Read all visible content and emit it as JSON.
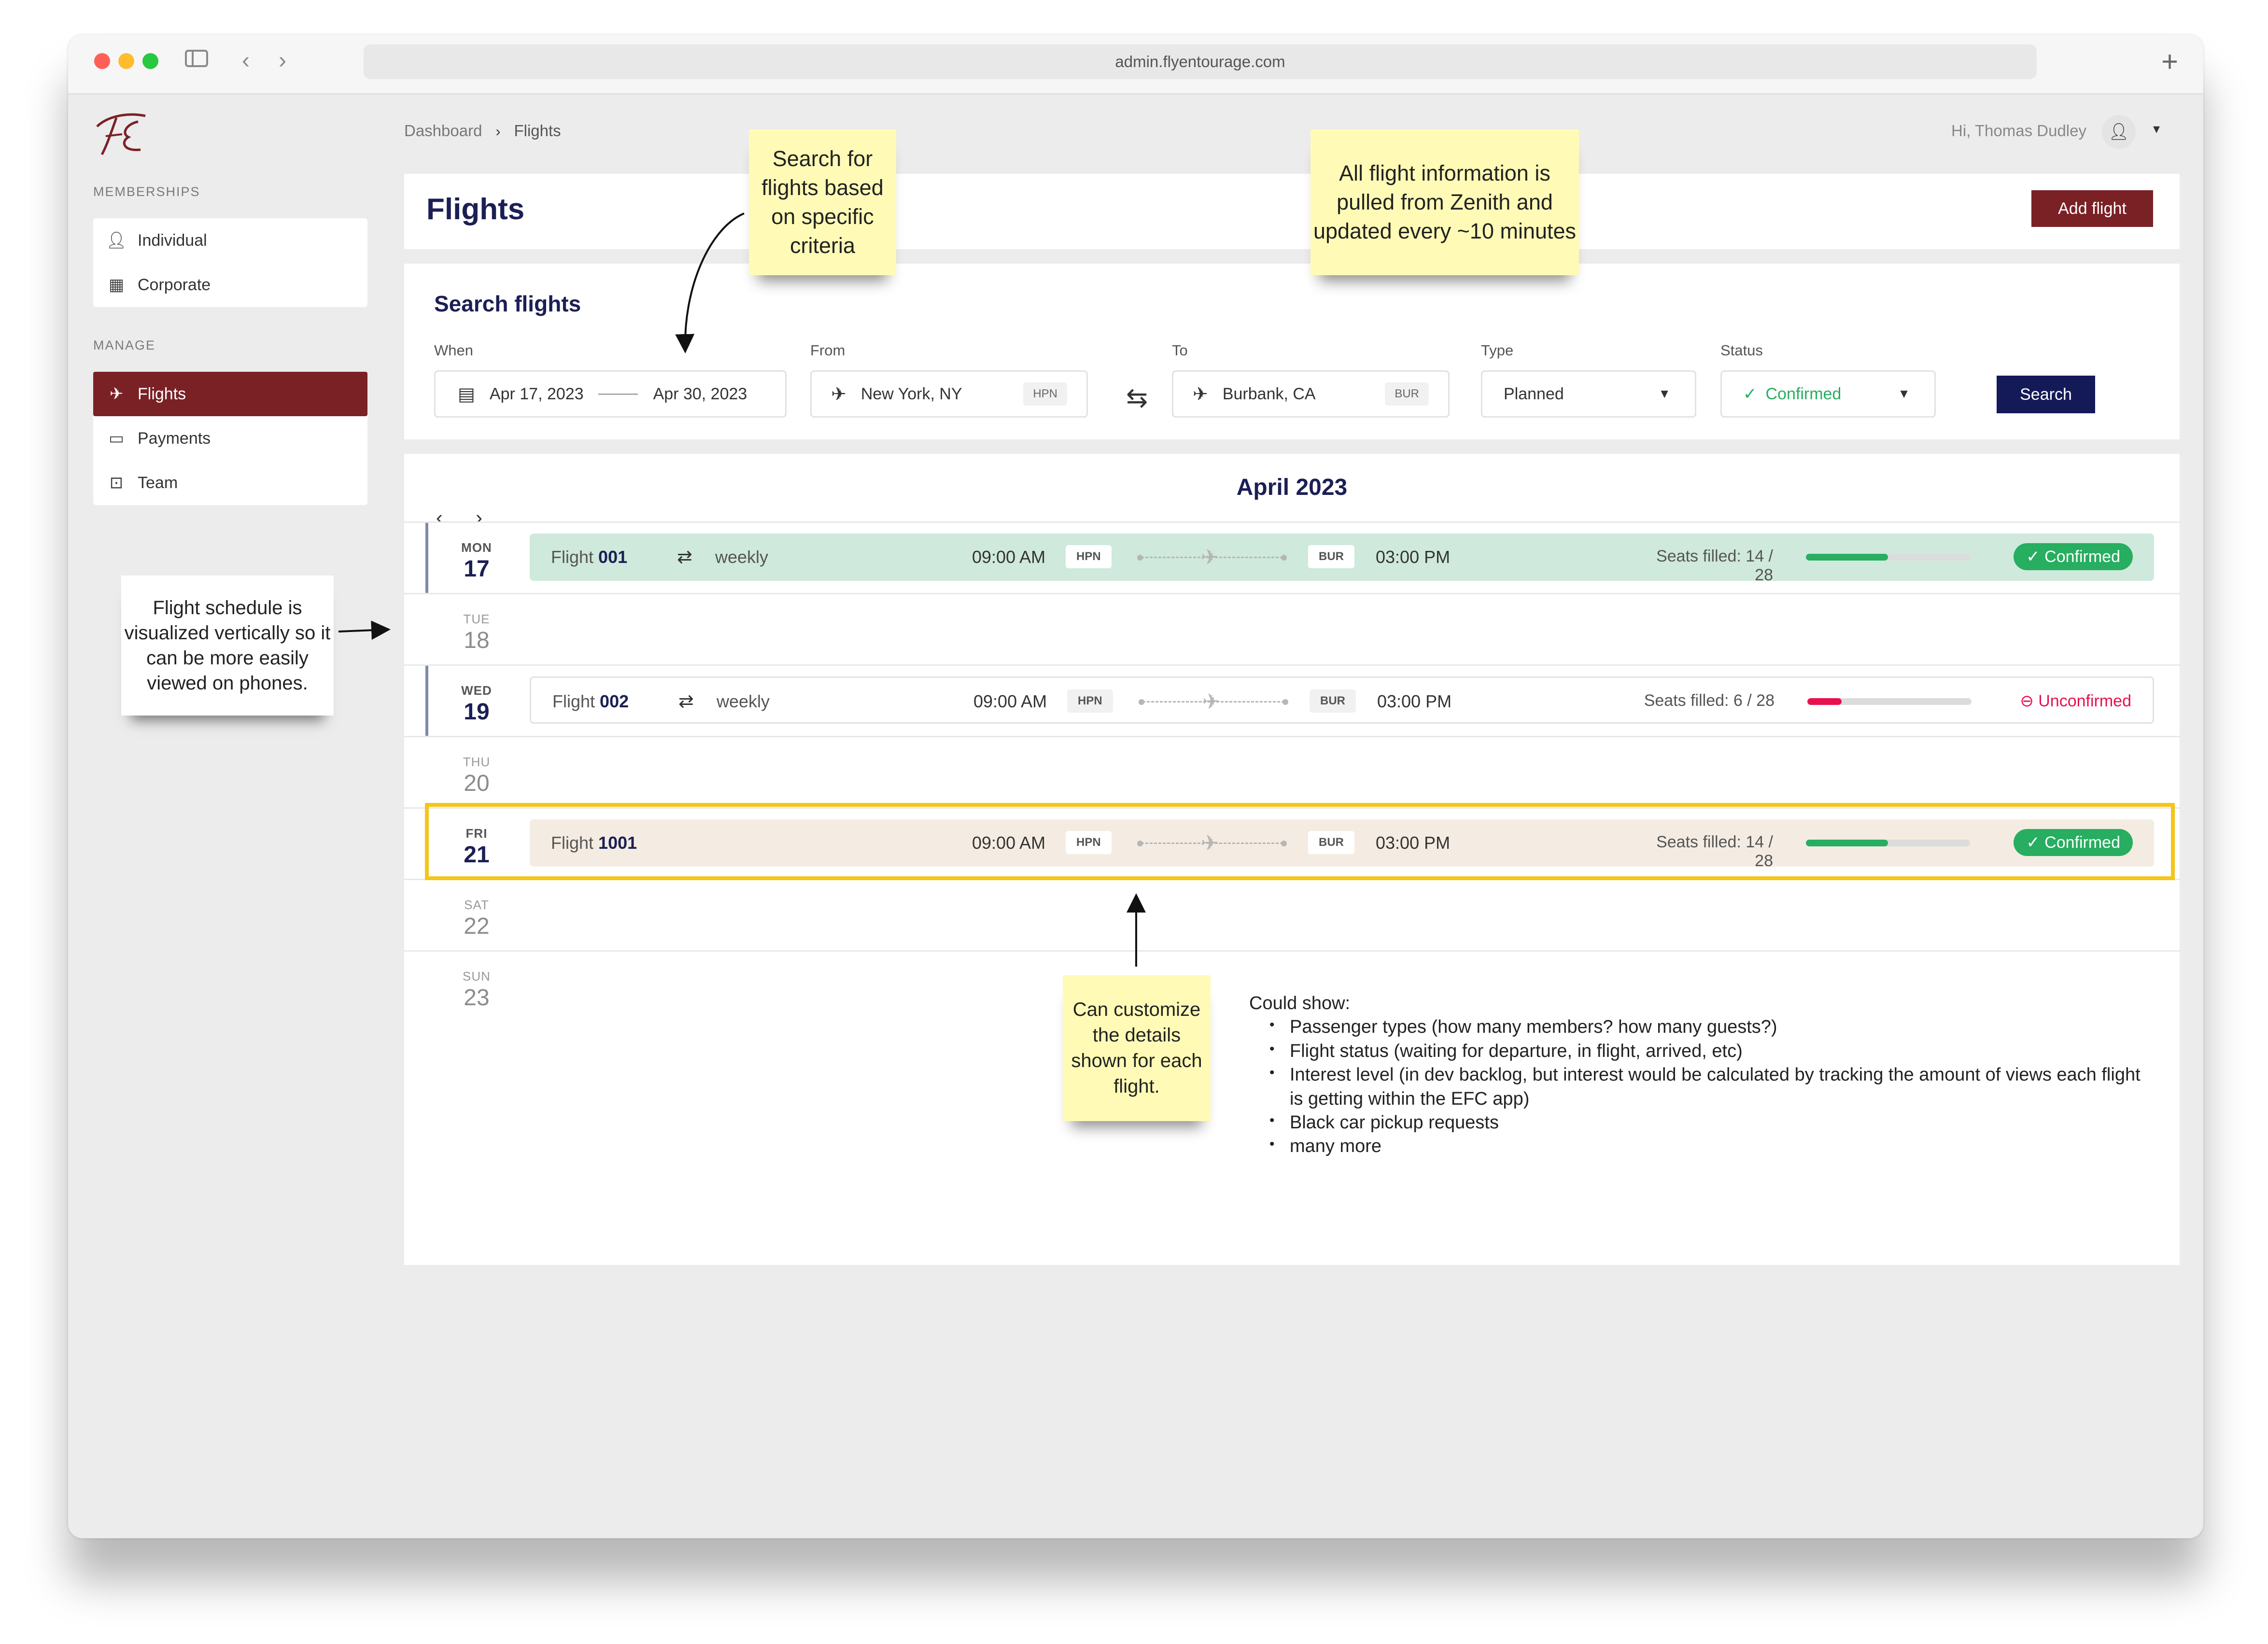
{
  "browser": {
    "url": "admin.flyentourage.com"
  },
  "sidebar": {
    "memberships_heading": "MEMBERSHIPS",
    "memberships": [
      {
        "label": "Individual",
        "icon": "person-icon"
      },
      {
        "label": "Corporate",
        "icon": "building-icon"
      }
    ],
    "manage_heading": "MANAGE",
    "manage": [
      {
        "label": "Flights",
        "icon": "plane-icon",
        "active": true
      },
      {
        "label": "Payments",
        "icon": "card-icon"
      },
      {
        "label": "Team",
        "icon": "team-icon"
      }
    ]
  },
  "header": {
    "breadcrumb": [
      "Dashboard",
      "Flights"
    ],
    "greeting": "Hi, Thomas Dudley"
  },
  "page": {
    "title": "Flights",
    "add_button": "Add flight"
  },
  "search": {
    "title": "Search flights",
    "when_label": "When",
    "date_from": "Apr 17, 2023",
    "date_to": "Apr 30, 2023",
    "from_label": "From",
    "from_city": "New York, NY",
    "from_code": "HPN",
    "to_label": "To",
    "to_city": "Burbank, CA",
    "to_code": "BUR",
    "type_label": "Type",
    "type_value": "Planned",
    "status_label": "Status",
    "status_value": "Confirmed",
    "search_button": "Search"
  },
  "calendar": {
    "month": "April 2023",
    "days": [
      {
        "dow": "MON",
        "dom": "17"
      },
      {
        "dow": "TUE",
        "dom": "18"
      },
      {
        "dow": "WED",
        "dom": "19"
      },
      {
        "dow": "THU",
        "dom": "20"
      },
      {
        "dow": "FRI",
        "dom": "21"
      },
      {
        "dow": "SAT",
        "dom": "22"
      },
      {
        "dow": "SUN",
        "dom": "23"
      }
    ],
    "flights": [
      {
        "prefix": "Flight",
        "number": "001",
        "repeat": "weekly",
        "dep_time": "09:00 AM",
        "from": "HPN",
        "to": "BUR",
        "arr_time": "03:00 PM",
        "seats": "Seats filled: 14 / 28",
        "fill": 0.5,
        "status": "Confirmed",
        "color": "#27ae60"
      },
      {
        "prefix": "Flight",
        "number": "002",
        "repeat": "weekly",
        "dep_time": "09:00 AM",
        "from": "HPN",
        "to": "BUR",
        "arr_time": "03:00 PM",
        "seats": "Seats filled: 6 / 28",
        "fill": 0.21,
        "status": "Unconfirmed",
        "color": "#e8114f"
      },
      {
        "prefix": "Flight",
        "number": "1001",
        "dep_time": "09:00 AM",
        "from": "HPN",
        "to": "BUR",
        "arr_time": "03:00 PM",
        "seats": "Seats filled: 14 / 28",
        "fill": 0.5,
        "status": "Confirmed",
        "color": "#27ae60"
      }
    ]
  },
  "annotations": {
    "search_note": "Search for flights based on specific criteria",
    "zenith_note": "All flight information is pulled from Zenith and updated every ~10 minutes",
    "vertical_note": "Flight schedule is visualized vertically so it can be more easily viewed on phones.",
    "customize_note": "Can customize the details shown for each flight.",
    "could_show_title": "Could show:",
    "could_show": [
      "Passenger types (how many members? how many guests?)",
      "Flight status (waiting for departure, in flight, arrived, etc)",
      "Interest level (in dev backlog, but interest would be calculated by tracking the amount of views each flight is getting within the EFC app)",
      "Black car pickup requests",
      "many more"
    ]
  }
}
